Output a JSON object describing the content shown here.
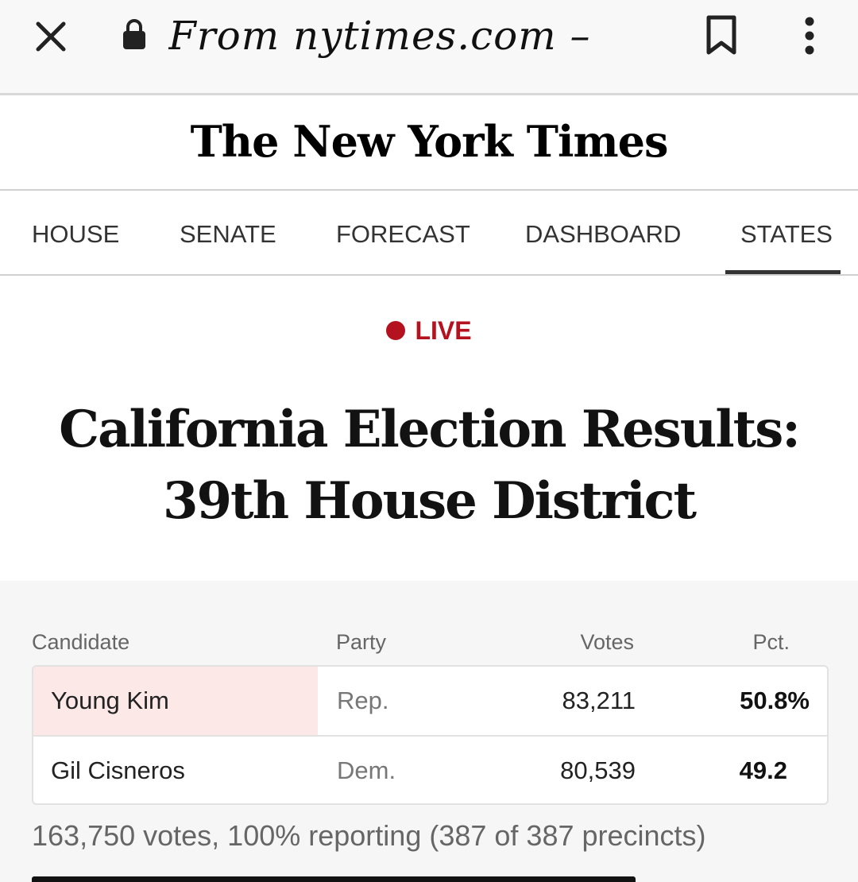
{
  "browser": {
    "url_text": "From nytimes.com – ",
    "icons": {
      "close": "close-icon",
      "lock": "lock-icon",
      "bookmark": "bookmark-icon",
      "menu": "more-vertical-icon"
    }
  },
  "masthead": {
    "logo": "The New York Times"
  },
  "nav": {
    "tabs": [
      {
        "label": "HOUSE"
      },
      {
        "label": "SENATE"
      },
      {
        "label": "FORECAST"
      },
      {
        "label": "DASHBOARD"
      },
      {
        "label": "STATES",
        "active": true
      }
    ]
  },
  "live": {
    "label": "LIVE",
    "color": "#b3121e"
  },
  "headline": {
    "line1": "California Election Results:",
    "line2": "39th House District"
  },
  "results": {
    "columns": {
      "candidate": "Candidate",
      "party": "Party",
      "votes": "Votes",
      "pct": "Pct."
    },
    "rows": [
      {
        "candidate": "Young Kim",
        "party": "Rep.",
        "votes": "83,211",
        "pct": "50.8%",
        "winner": true,
        "highlight_color": "#fde8e8"
      },
      {
        "candidate": "Gil Cisneros",
        "party": "Dem.",
        "votes": "80,539",
        "pct": "49.2",
        "winner": false
      }
    ],
    "summary": "163,750 votes, 100% reporting (387 of 387 precincts)"
  }
}
